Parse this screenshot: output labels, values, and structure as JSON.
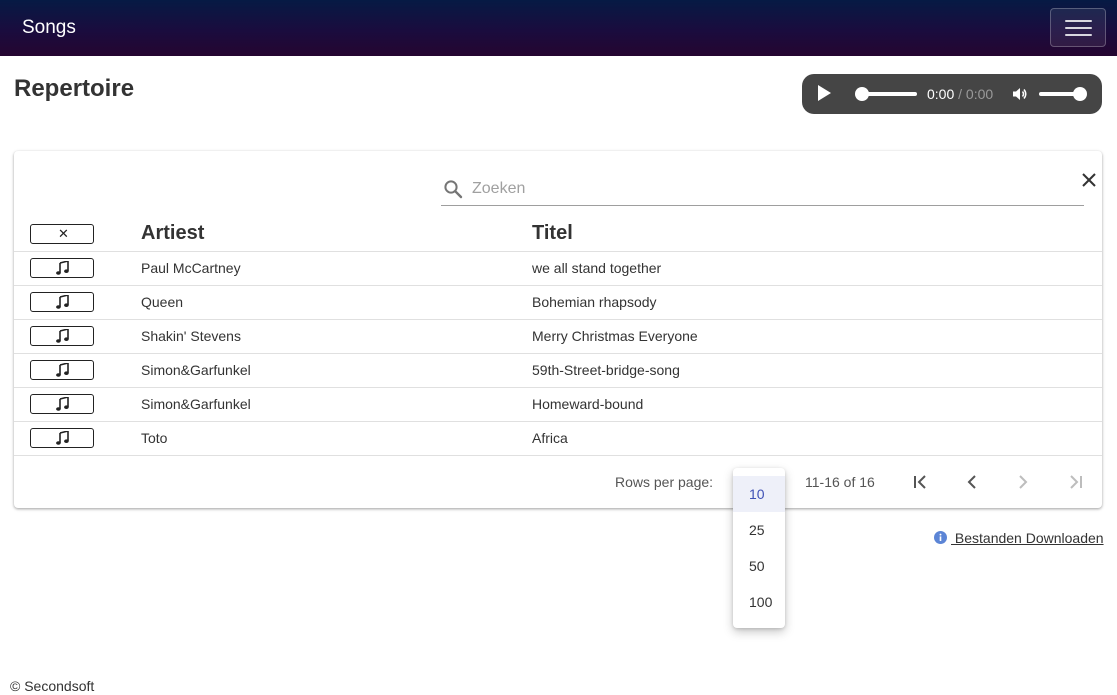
{
  "navbar": {
    "brand": "Songs"
  },
  "page": {
    "title": "Repertoire"
  },
  "player": {
    "current_time": "0:00",
    "separator": "/",
    "duration": "0:00",
    "progress": 0,
    "volume": 1
  },
  "search": {
    "placeholder": "Zoeken",
    "value": ""
  },
  "table": {
    "columns": [
      "Artiest",
      "Titel"
    ],
    "clear_button_label": "✕",
    "rows": [
      {
        "artist": "Paul McCartney",
        "title": "we all stand together"
      },
      {
        "artist": "Queen",
        "title": "Bohemian rhapsody"
      },
      {
        "artist": "Shakin' Stevens",
        "title": "Merry Christmas Everyone"
      },
      {
        "artist": "Simon&Garfunkel",
        "title": "59th-Street-bridge-song"
      },
      {
        "artist": "Simon&Garfunkel",
        "title": "Homeward-bound"
      },
      {
        "artist": "Toto",
        "title": "Africa"
      }
    ]
  },
  "pagination": {
    "rows_per_page_label": "Rows per page:",
    "range": "11-16 of 16",
    "options": [
      "10",
      "25",
      "50",
      "100"
    ],
    "selected": "10"
  },
  "download": {
    "label": " Bestanden Downloaden"
  },
  "footer": {
    "copyright": "© Secondsoft"
  },
  "colors": {
    "accent": "#3f51b5",
    "info": "#5c85d6",
    "player_bg": "#454545"
  }
}
